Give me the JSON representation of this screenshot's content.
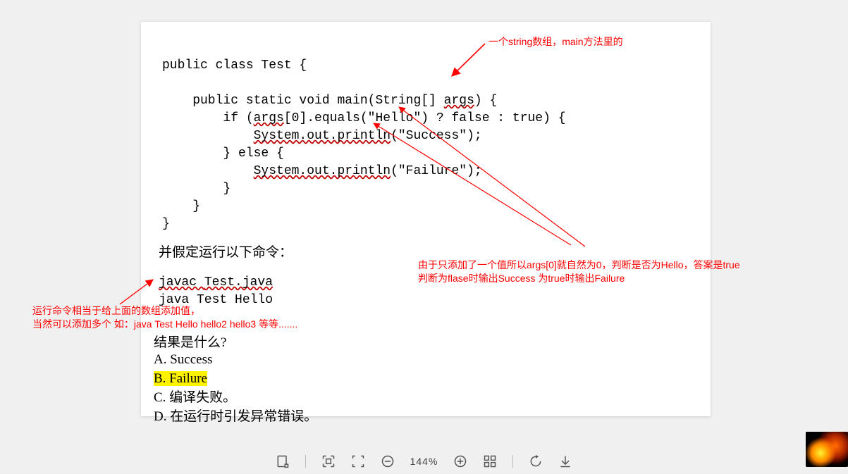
{
  "annotations": {
    "top_right": "一个string数组，main方法里的",
    "left_note_l1": "运行命令相当于给上面的数组添加值，",
    "left_note_l2": "当然可以添加多个 如：java Test Hello hello2 hello3 等等.......",
    "right_note_l1": "由于只添加了一个值所以args[0]就自然为0，判断是否为Hello，答案是true",
    "right_note_l2": "判断为flase时输出Success 为true时输出Failure"
  },
  "code": {
    "l1_a": "public class Test {",
    "l2_a": "    public static void main(String[] ",
    "l2_b": "args",
    "l2_c": ") {",
    "l3_a": "        if (",
    "l3_b": "args",
    "l3_c": "[0].equals(\"Hello\") ? false : true) {",
    "l4_a": "            ",
    "l4_b": "System.out.println",
    "l4_c": "(\"Success\");",
    "l5_a": "        } else {",
    "l6_a": "            ",
    "l6_b": "System.out.println",
    "l6_c": "(\"Failure\");",
    "l7_a": "        }",
    "l8_a": "    }",
    "l9_a": "}"
  },
  "text": {
    "assume": "并假定运行以下命令：",
    "cmd1_a": "javac ",
    "cmd1_b": "Test.java",
    "cmd2": "java Test Hello",
    "result_q": "结果是什么?",
    "opt_a": "A. Success",
    "opt_b": "B. Failure",
    "opt_c": "C. 编译失败。",
    "opt_d": "D. 在运行时引发异常错误。"
  },
  "toolbar": {
    "zoom": "144%"
  },
  "colors": {
    "annotation_red": "#ff0000",
    "highlight_yellow": "#fff200"
  }
}
